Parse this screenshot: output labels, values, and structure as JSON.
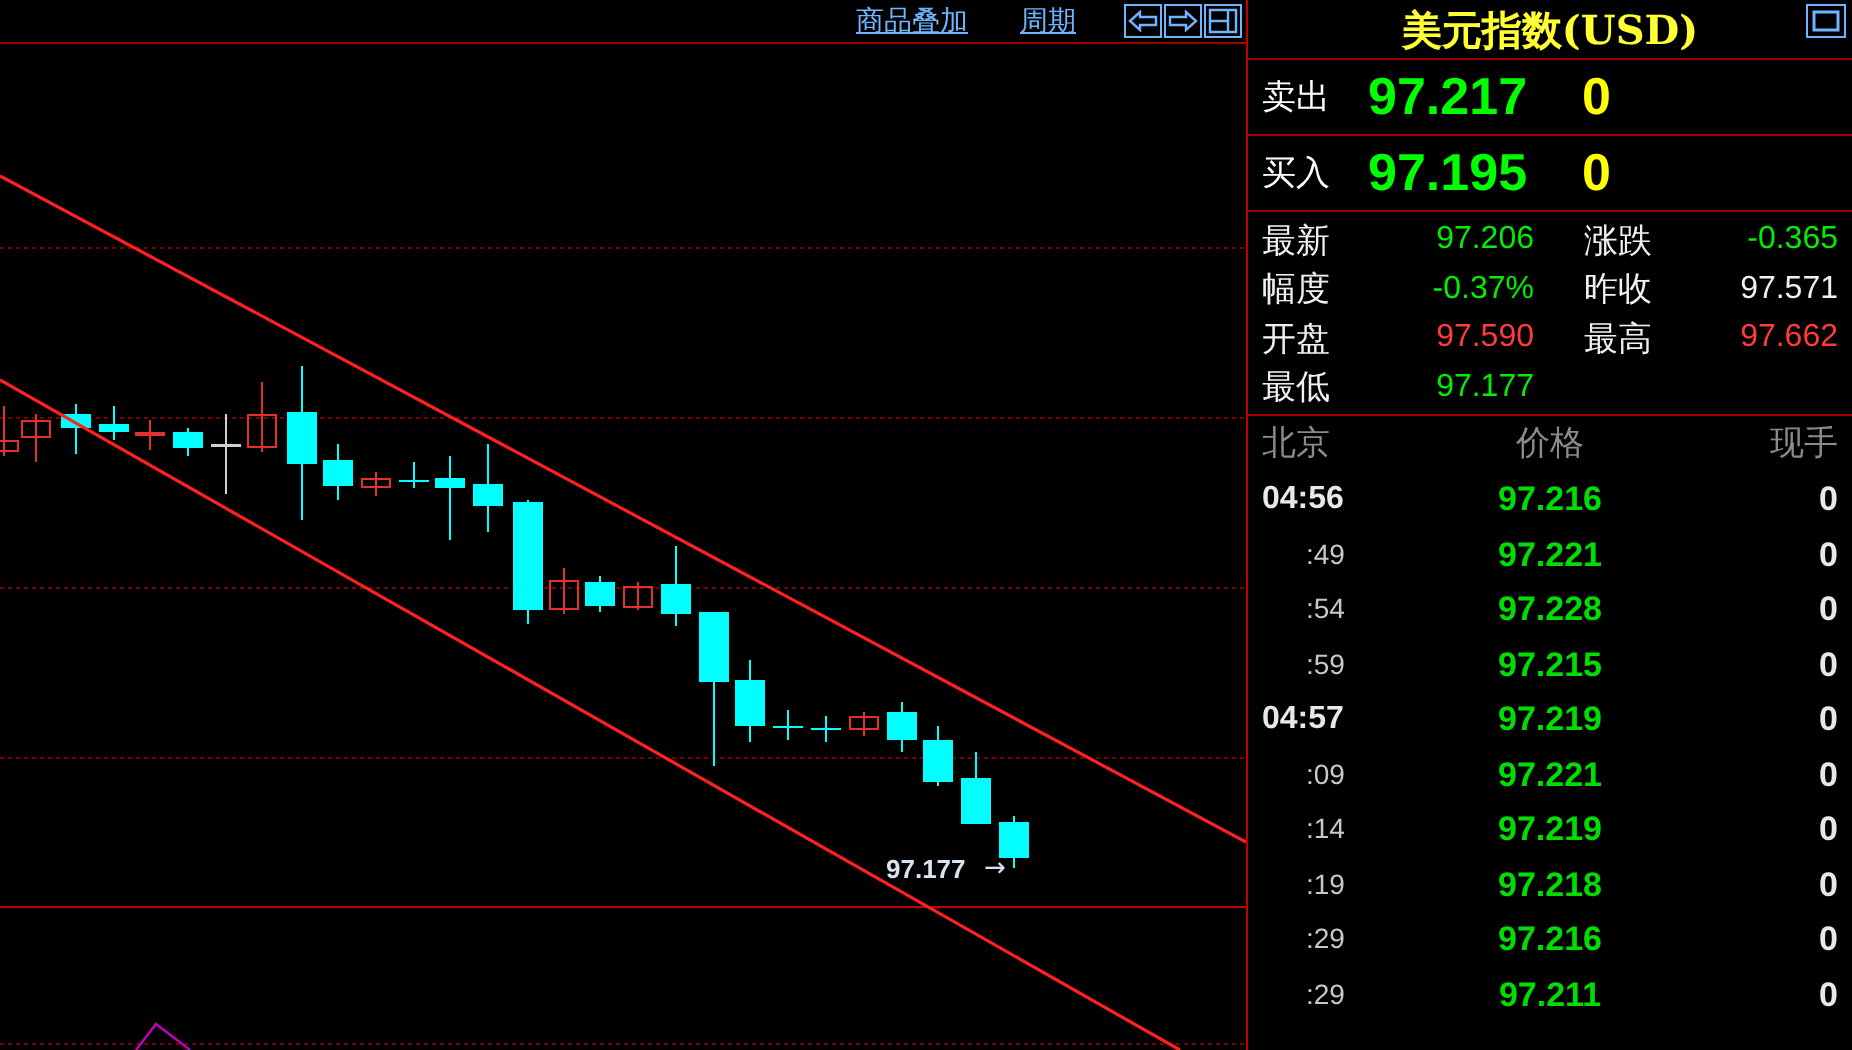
{
  "toolbar": {
    "links": [
      "商品叠加",
      "周期"
    ]
  },
  "chart": {
    "last_price_label": "97.177",
    "arrow": "→"
  },
  "quote": {
    "title": "美元指数(USD)",
    "ask": {
      "label": "卖出",
      "price": "97.217",
      "volume": "0"
    },
    "bid": {
      "label": "买入",
      "price": "97.195",
      "volume": "0"
    },
    "stats": [
      {
        "label": "最新",
        "value": "97.206",
        "color": "#00ee00"
      },
      {
        "label": "涨跌",
        "value": "-0.365",
        "color": "#00ee00"
      },
      {
        "label": "幅度",
        "value": "-0.37%",
        "color": "#00ee00"
      },
      {
        "label": "昨收",
        "value": "97.571",
        "color": "#f0f0f0"
      },
      {
        "label": "开盘",
        "value": "97.590",
        "color": "#ff3b3b"
      },
      {
        "label": "最高",
        "value": "97.662",
        "color": "#ff3b3b"
      },
      {
        "label": "最低",
        "value": "97.177",
        "color": "#00ee00"
      }
    ]
  },
  "ticks": {
    "columns": [
      "北京",
      "价格",
      "现手"
    ],
    "rows": [
      {
        "time": "04:56",
        "kind": "minute",
        "price": "97.216",
        "volume": "0"
      },
      {
        "time": ":49",
        "kind": "second",
        "price": "97.221",
        "volume": "0"
      },
      {
        "time": ":54",
        "kind": "second",
        "price": "97.228",
        "volume": "0"
      },
      {
        "time": ":59",
        "kind": "second",
        "price": "97.215",
        "volume": "0"
      },
      {
        "time": "04:57",
        "kind": "minute",
        "price": "97.219",
        "volume": "0"
      },
      {
        "time": ":09",
        "kind": "second",
        "price": "97.221",
        "volume": "0"
      },
      {
        "time": ":14",
        "kind": "second",
        "price": "97.219",
        "volume": "0"
      },
      {
        "time": ":19",
        "kind": "second",
        "price": "97.218",
        "volume": "0"
      },
      {
        "time": ":29",
        "kind": "second",
        "price": "97.216",
        "volume": "0"
      },
      {
        "time": ":29",
        "kind": "second",
        "price": "97.211",
        "volume": "0"
      }
    ]
  }
}
